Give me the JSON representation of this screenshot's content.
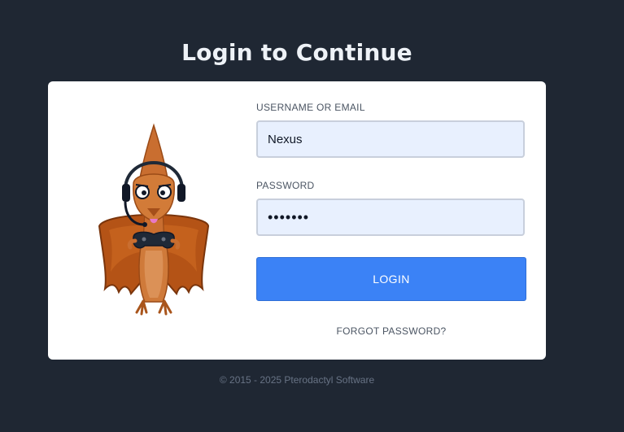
{
  "header": {
    "title": "Login to Continue"
  },
  "form": {
    "username_label": "USERNAME OR EMAIL",
    "username_value": "Nexus",
    "password_label": "PASSWORD",
    "password_value": "•••••••",
    "login_button": "LOGIN",
    "forgot_link": "FORGOT PASSWORD?"
  },
  "mascot": {
    "icon": "pterodactyl-mascot-icon"
  },
  "footer": {
    "copyright": "© 2015 - 2025 Pterodactyl Software"
  },
  "colors": {
    "background": "#1f2733",
    "card": "#ffffff",
    "primary": "#3b82f6",
    "input_background": "#e8f0fe"
  }
}
